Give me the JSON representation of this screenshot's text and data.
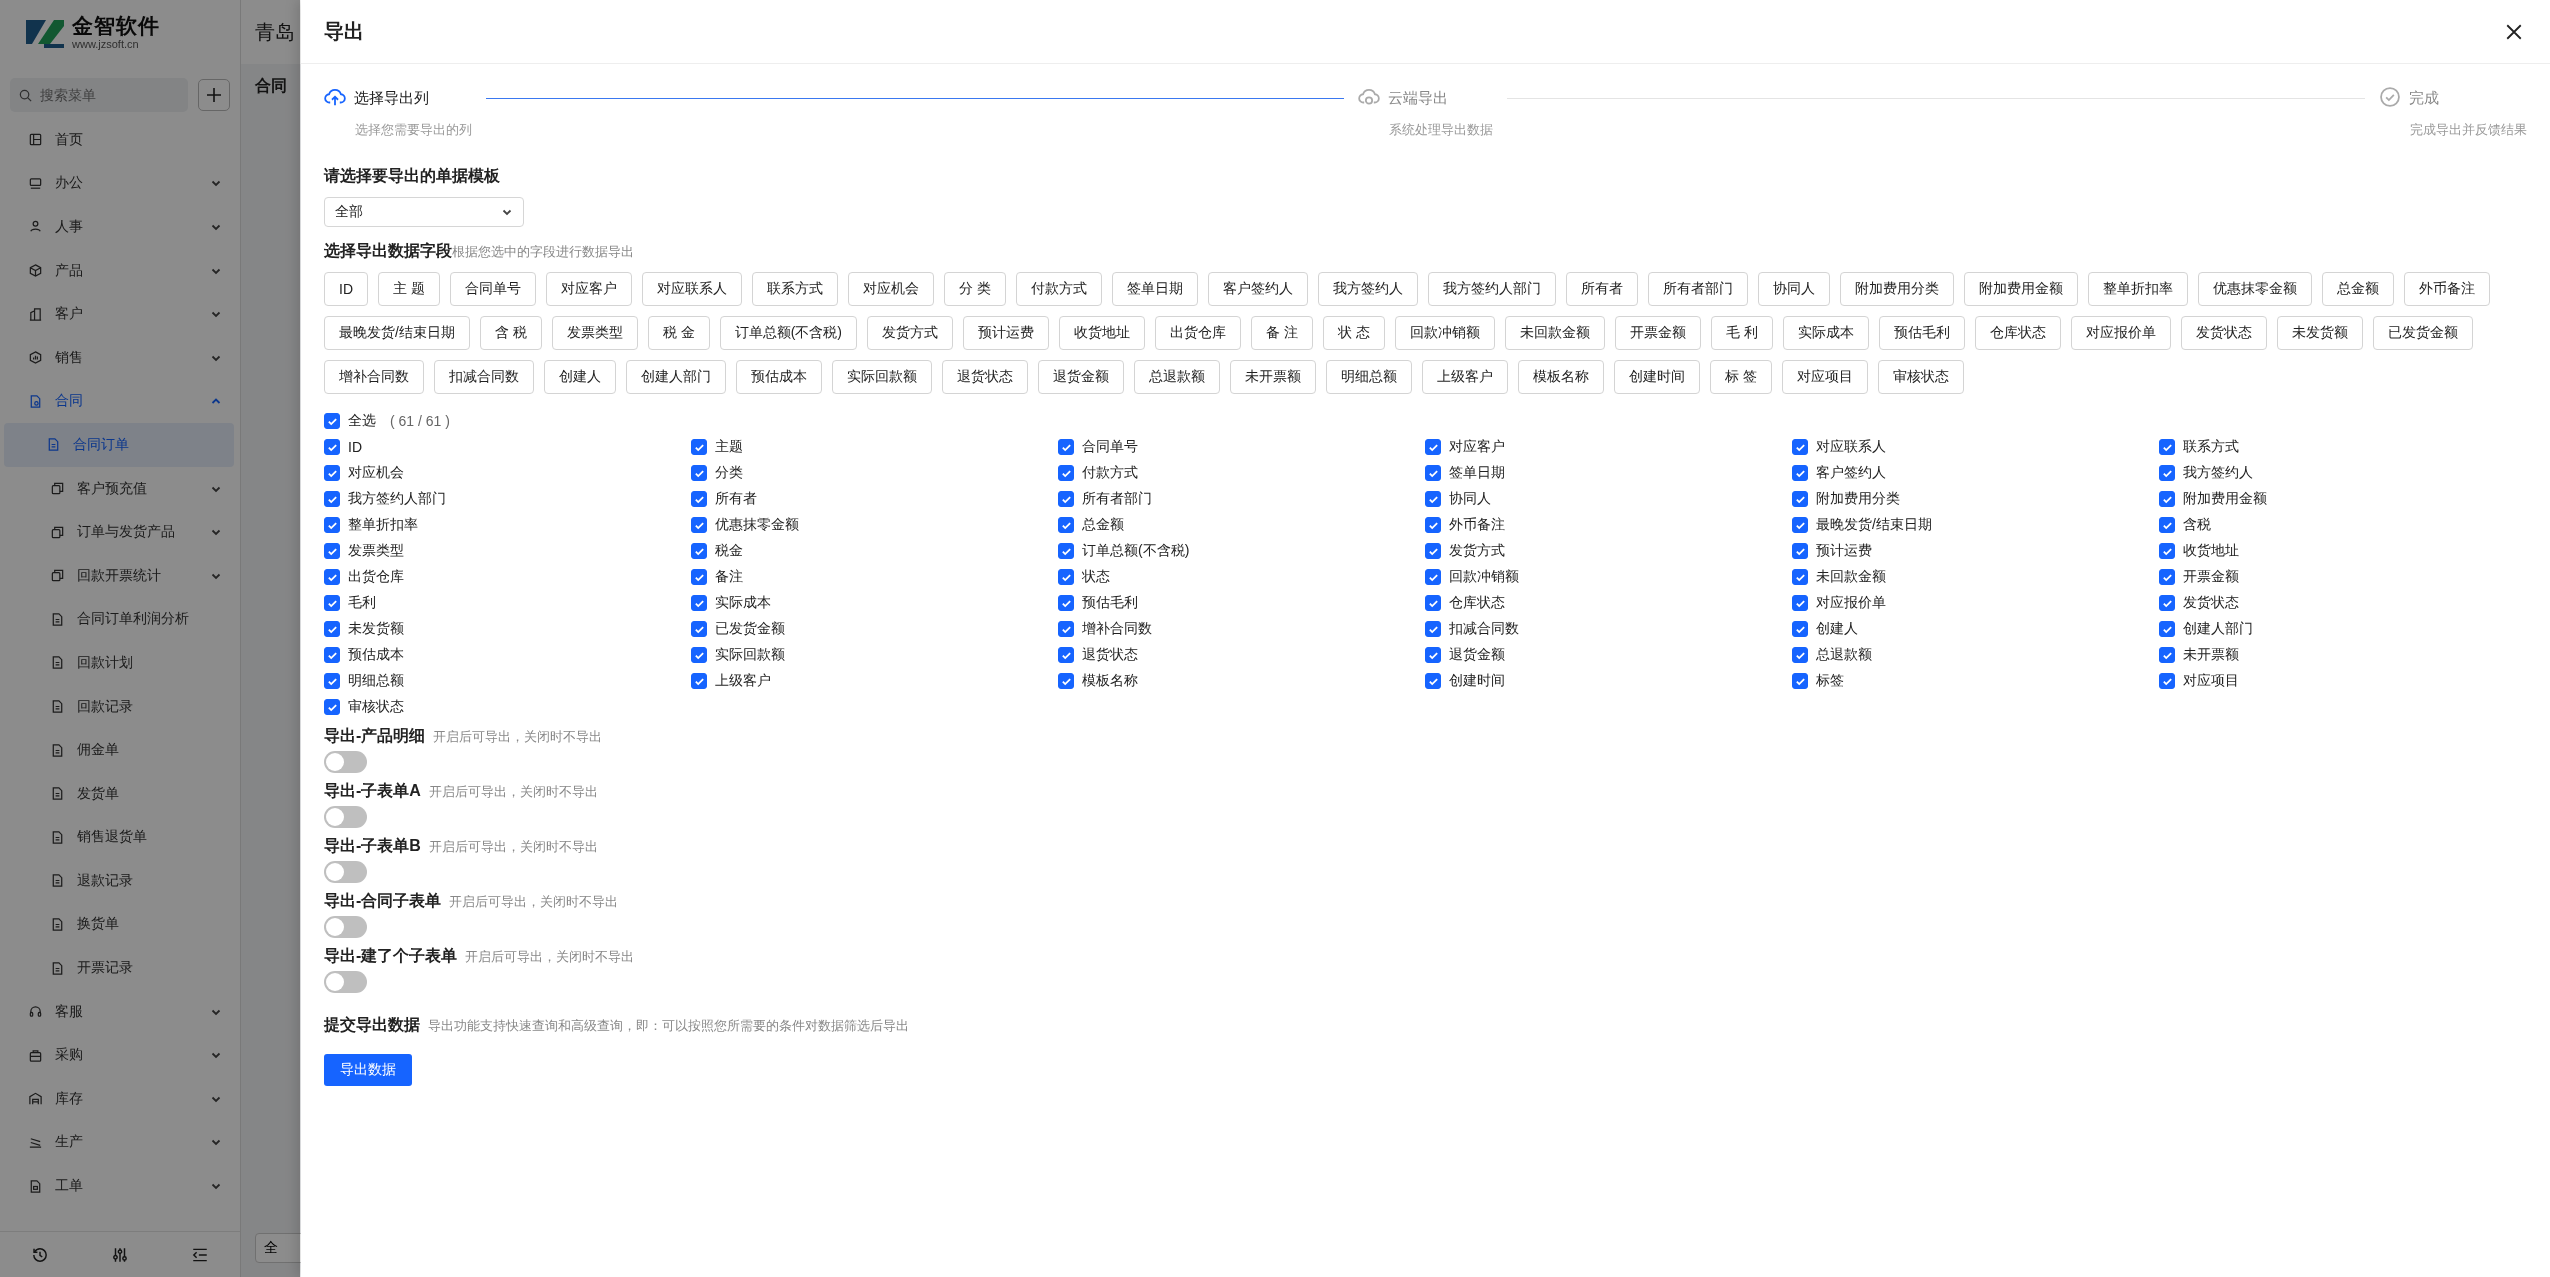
{
  "sidebar": {
    "logo": {
      "name": "金智软件",
      "url": "www.jzsoft.cn"
    },
    "search": {
      "placeholder": "搜索菜单"
    },
    "items": [
      {
        "label": "首页",
        "selected": false
      },
      {
        "label": "办公",
        "selected": false,
        "expanded": false
      },
      {
        "label": "人事",
        "selected": false,
        "expanded": false
      },
      {
        "label": "产品",
        "selected": false,
        "expanded": false
      },
      {
        "label": "客户",
        "selected": false,
        "expanded": false
      },
      {
        "label": "销售",
        "selected": false,
        "expanded": false
      },
      {
        "label": "合同",
        "selected": false,
        "expanded": true,
        "children": [
          {
            "label": "合同订单",
            "selected": true
          },
          {
            "label": "客户预充值",
            "selected": false,
            "expanded": false
          },
          {
            "label": "订单与发货产品",
            "selected": false,
            "expanded": false
          },
          {
            "label": "回款开票统计",
            "selected": false,
            "expanded": false
          },
          {
            "label": "合同订单利润分析",
            "selected": false
          },
          {
            "label": "回款计划",
            "selected": false
          },
          {
            "label": "回款记录",
            "selected": false
          },
          {
            "label": "佣金单",
            "selected": false
          },
          {
            "label": "发货单",
            "selected": false
          },
          {
            "label": "销售退货单",
            "selected": false
          },
          {
            "label": "退款记录",
            "selected": false
          },
          {
            "label": "换货单",
            "selected": false
          },
          {
            "label": "开票记录",
            "selected": false
          }
        ]
      },
      {
        "label": "客服",
        "selected": false,
        "expanded": false
      },
      {
        "label": "采购",
        "selected": false,
        "expanded": false
      },
      {
        "label": "库存",
        "selected": false,
        "expanded": false
      },
      {
        "label": "生产",
        "selected": false,
        "expanded": false
      },
      {
        "label": "工单",
        "selected": false,
        "expanded": false
      }
    ]
  },
  "background": {
    "header_title": "青岛",
    "tab": "合同",
    "button": "全"
  },
  "dialog": {
    "title": "导出",
    "steps": [
      {
        "title": "选择导出列",
        "description": "选择您需要导出的列",
        "active": true
      },
      {
        "title": "云端导出",
        "description": "系统处理导出数据",
        "active": false
      },
      {
        "title": "完成",
        "description": "完成导出并反馈结果",
        "active": false
      }
    ],
    "template": {
      "label": "请选择要导出的单据模板",
      "value": "全部"
    },
    "fields_section": {
      "title": "选择导出数据字段",
      "hint": "根据您选中的字段进行数据导出"
    },
    "tags": [
      "ID",
      "主 题",
      "合同单号",
      "对应客户",
      "对应联系人",
      "联系方式",
      "对应机会",
      "分 类",
      "付款方式",
      "签单日期",
      "客户签约人",
      "我方签约人",
      "我方签约人部门",
      "所有者",
      "所有者部门",
      "协同人",
      "附加费用分类",
      "附加费用金额",
      "整单折扣率",
      "优惠抹零金额",
      "总金额",
      "外币备注",
      "最晚发货/结束日期",
      "含 税",
      "发票类型",
      "税 金",
      "订单总额(不含税)",
      "发货方式",
      "预计运费",
      "收货地址",
      "出货仓库",
      "备 注",
      "状 态",
      "回款冲销额",
      "未回款金额",
      "开票金额",
      "毛 利",
      "实际成本",
      "预估毛利",
      "仓库状态",
      "对应报价单",
      "发货状态",
      "未发货额",
      "已发货金额",
      "增补合同数",
      "扣减合同数",
      "创建人",
      "创建人部门",
      "预估成本",
      "实际回款额",
      "退货状态",
      "退货金额",
      "总退款额",
      "未开票额",
      "明细总额",
      "上级客户",
      "模板名称",
      "创建时间",
      "标 签",
      "对应项目",
      "审核状态"
    ],
    "select_all": {
      "label": "全选",
      "count": "( 61 / 61 )",
      "checked": true
    },
    "fields": [
      {
        "label": "ID",
        "checked": true
      },
      {
        "label": "主题",
        "checked": true
      },
      {
        "label": "合同单号",
        "checked": true
      },
      {
        "label": "对应客户",
        "checked": true
      },
      {
        "label": "对应联系人",
        "checked": true
      },
      {
        "label": "联系方式",
        "checked": true
      },
      {
        "label": "对应机会",
        "checked": true
      },
      {
        "label": "分类",
        "checked": true
      },
      {
        "label": "付款方式",
        "checked": true
      },
      {
        "label": "签单日期",
        "checked": true
      },
      {
        "label": "客户签约人",
        "checked": true
      },
      {
        "label": "我方签约人",
        "checked": true
      },
      {
        "label": "我方签约人部门",
        "checked": true
      },
      {
        "label": "所有者",
        "checked": true
      },
      {
        "label": "所有者部门",
        "checked": true
      },
      {
        "label": "协同人",
        "checked": true
      },
      {
        "label": "附加费用分类",
        "checked": true
      },
      {
        "label": "附加费用金额",
        "checked": true
      },
      {
        "label": "整单折扣率",
        "checked": true
      },
      {
        "label": "优惠抹零金额",
        "checked": true
      },
      {
        "label": "总金额",
        "checked": true
      },
      {
        "label": "外币备注",
        "checked": true
      },
      {
        "label": "最晚发货/结束日期",
        "checked": true
      },
      {
        "label": "含税",
        "checked": true
      },
      {
        "label": "发票类型",
        "checked": true
      },
      {
        "label": "税金",
        "checked": true
      },
      {
        "label": "订单总额(不含税)",
        "checked": true
      },
      {
        "label": "发货方式",
        "checked": true
      },
      {
        "label": "预计运费",
        "checked": true
      },
      {
        "label": "收货地址",
        "checked": true
      },
      {
        "label": "出货仓库",
        "checked": true
      },
      {
        "label": "备注",
        "checked": true
      },
      {
        "label": "状态",
        "checked": true
      },
      {
        "label": "回款冲销额",
        "checked": true
      },
      {
        "label": "未回款金额",
        "checked": true
      },
      {
        "label": "开票金额",
        "checked": true
      },
      {
        "label": "毛利",
        "checked": true
      },
      {
        "label": "实际成本",
        "checked": true
      },
      {
        "label": "预估毛利",
        "checked": true
      },
      {
        "label": "仓库状态",
        "checked": true
      },
      {
        "label": "对应报价单",
        "checked": true
      },
      {
        "label": "发货状态",
        "checked": true
      },
      {
        "label": "未发货额",
        "checked": true
      },
      {
        "label": "已发货金额",
        "checked": true
      },
      {
        "label": "增补合同数",
        "checked": true
      },
      {
        "label": "扣减合同数",
        "checked": true
      },
      {
        "label": "创建人",
        "checked": true
      },
      {
        "label": "创建人部门",
        "checked": true
      },
      {
        "label": "预估成本",
        "checked": true
      },
      {
        "label": "实际回款额",
        "checked": true
      },
      {
        "label": "退货状态",
        "checked": true
      },
      {
        "label": "退货金额",
        "checked": true
      },
      {
        "label": "总退款额",
        "checked": true
      },
      {
        "label": "未开票额",
        "checked": true
      },
      {
        "label": "明细总额",
        "checked": true
      },
      {
        "label": "上级客户",
        "checked": true
      },
      {
        "label": "模板名称",
        "checked": true
      },
      {
        "label": "创建时间",
        "checked": true
      },
      {
        "label": "标签",
        "checked": true
      },
      {
        "label": "对应项目",
        "checked": true
      },
      {
        "label": "审核状态",
        "checked": true
      }
    ],
    "toggles": [
      {
        "title": "导出-产品明细",
        "hint": "开启后可导出，关闭时不导出",
        "on": false
      },
      {
        "title": "导出-子表单A",
        "hint": "开启后可导出，关闭时不导出",
        "on": false
      },
      {
        "title": "导出-子表单B",
        "hint": "开启后可导出，关闭时不导出",
        "on": false
      },
      {
        "title": "导出-合同子表单",
        "hint": "开启后可导出，关闭时不导出",
        "on": false
      },
      {
        "title": "导出-建了个子表单",
        "hint": "开启后可导出，关闭时不导出",
        "on": false
      }
    ],
    "submit": {
      "title": "提交导出数据",
      "hint": "导出功能支持快速查询和高级查询，即：可以按照您所需要的条件对数据筛选后导出",
      "button": "导出数据"
    }
  }
}
